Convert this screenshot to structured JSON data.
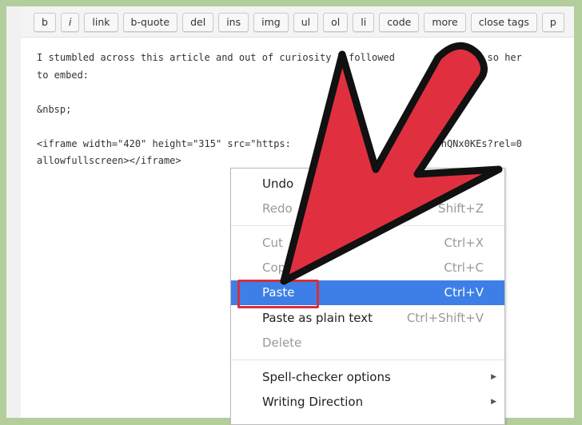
{
  "toolbar": {
    "buttons": [
      "b",
      "i",
      "link",
      "b-quote",
      "del",
      "ins",
      "img",
      "ul",
      "ol",
      "li",
      "code",
      "more",
      "close tags",
      "p"
    ]
  },
  "content": {
    "lines": [
      "I stumbled across this article and out of curiosity I followed        by step so her",
      "to embed:",
      "",
      "&nbsp;",
      "",
      "<iframe width=\"420\" height=\"315\" src=\"https:                 embed/fQ9nQNx0KEs?rel=0",
      "allowfullscreen></iframe>"
    ]
  },
  "context_menu": {
    "items": [
      {
        "label": "Undo",
        "shortcut": "",
        "disabled": false
      },
      {
        "label": "Redo",
        "shortcut": "Shift+Z",
        "disabled": true
      },
      {
        "label": "Cut",
        "shortcut": "Ctrl+X",
        "disabled": true
      },
      {
        "label": "Copy",
        "shortcut": "Ctrl+C",
        "disabled": true
      },
      {
        "label": "Paste",
        "shortcut": "Ctrl+V",
        "disabled": false,
        "highlighted": true
      },
      {
        "label": "Paste as plain text",
        "shortcut": "Ctrl+Shift+V",
        "disabled": false
      },
      {
        "label": "Delete",
        "shortcut": "",
        "disabled": true
      },
      {
        "label": "Spell-checker options",
        "shortcut": "",
        "submenu": true
      },
      {
        "label": "Writing Direction",
        "shortcut": "",
        "submenu": true
      }
    ]
  },
  "colors": {
    "highlight": "#3d7fe6",
    "arrow": "#e0303f",
    "background": "#b3cd9c",
    "annotation_box": "#d5303c"
  },
  "icons": {
    "submenu": "chevron-right-icon",
    "pointer": "red-arrow-icon"
  }
}
